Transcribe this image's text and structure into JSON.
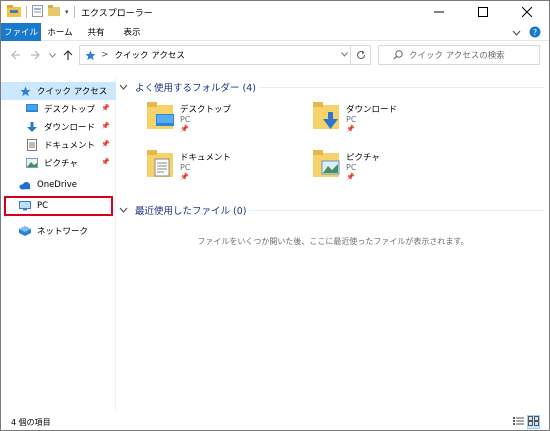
{
  "window": {
    "title": "エクスプローラー",
    "accent_color": "#1979ca"
  },
  "ribbon": {
    "tabs": [
      "ファイル",
      "ホーム",
      "共有",
      "表示"
    ]
  },
  "address": {
    "separator": ">",
    "path": "クイック アクセス"
  },
  "search": {
    "placeholder": "クイック アクセスの検索"
  },
  "sidebar": {
    "quick_access": "クイック アクセス",
    "pinned": [
      "デスクトップ",
      "ダウンロード",
      "ドキュメント",
      "ピクチャ"
    ],
    "onedrive": "OneDrive",
    "pc": "PC",
    "network": "ネットワーク"
  },
  "main": {
    "frequent_header": "よく使用するフォルダー (4)",
    "folders": [
      {
        "name": "デスクトップ",
        "location": "PC"
      },
      {
        "name": "ダウンロード",
        "location": "PC"
      },
      {
        "name": "ドキュメント",
        "location": "PC"
      },
      {
        "name": "ピクチャ",
        "location": "PC"
      }
    ],
    "recent_header": "最近使用したファイル (0)",
    "recent_empty": "ファイルをいくつか開いた後、ここに最近使ったファイルが表示されます。"
  },
  "status": {
    "item_count": "4 個の項目"
  },
  "highlight": {
    "color": "#d9001b"
  }
}
